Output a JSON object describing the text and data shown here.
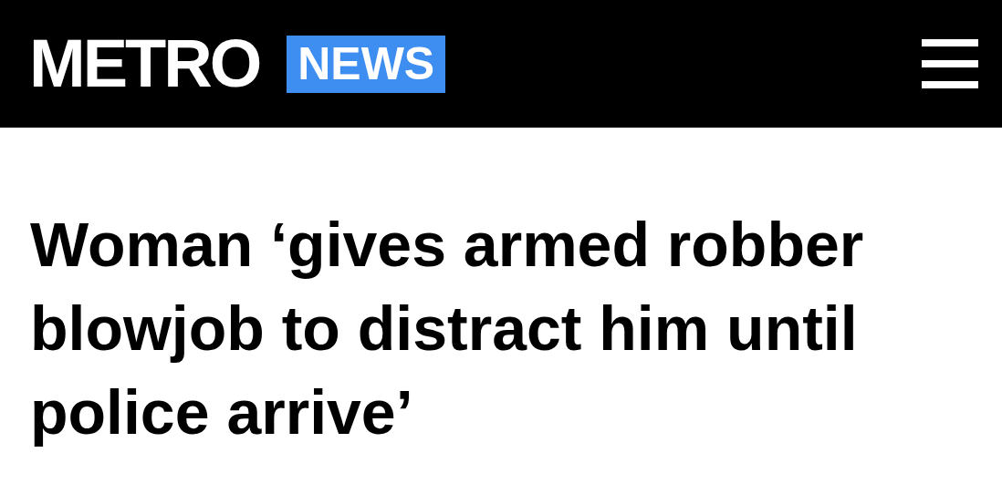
{
  "header": {
    "logo": "METRO",
    "section": "NEWS"
  },
  "article": {
    "headline": "Woman ‘gives armed robber blowjob to distract him until police arrive’"
  }
}
